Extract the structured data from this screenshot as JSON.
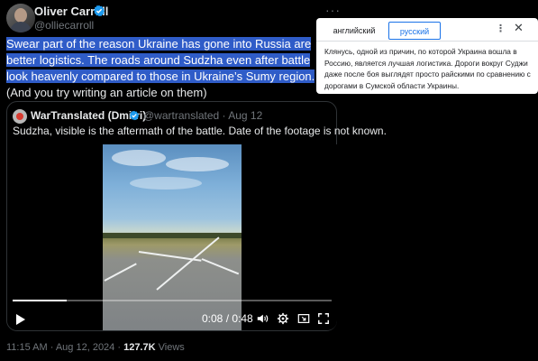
{
  "tweet": {
    "author_name": "Oliver Carroll",
    "author_handle": "@olliecarroll",
    "more_glyph": "···",
    "text_highlighted": "Swear part of the reason Ukraine has gone into Russia are better logistics. The roads around Sudzha even after battle look heavenly compared to those in Ukraine’s Sumy region.",
    "text_rest": " (And you try writing an article on them)",
    "time": "11:15 AM",
    "date": "Aug 12, 2024",
    "views_count": "127.7K",
    "views_label": "Views"
  },
  "quote": {
    "author_name": "WarTranslated (Dmitri)",
    "author_handle": "@wartranslated",
    "date": "Aug 12",
    "text": "Sudzha, visible is the aftermath of the battle. Date of the footage is not known.",
    "video": {
      "current_time": "0:08",
      "duration": "0:48",
      "progress_fraction": 0.17
    }
  },
  "translate_popup": {
    "tab_source": "английский",
    "tab_target": "русский",
    "menu_glyph": "⋮",
    "close_glyph": "✕",
    "translation": "Клянусь, одной из причин, по которой Украина вошла в Россию, является лучшая логистика. Дороги вокруг Суджи даже после боя выглядят просто райскими по сравнению с дорогами в Сумской области Украины."
  },
  "colors": {
    "verified_blue": "#1d9bf0",
    "highlight": "#2f5cc8",
    "google_blue": "#1a73e8"
  }
}
